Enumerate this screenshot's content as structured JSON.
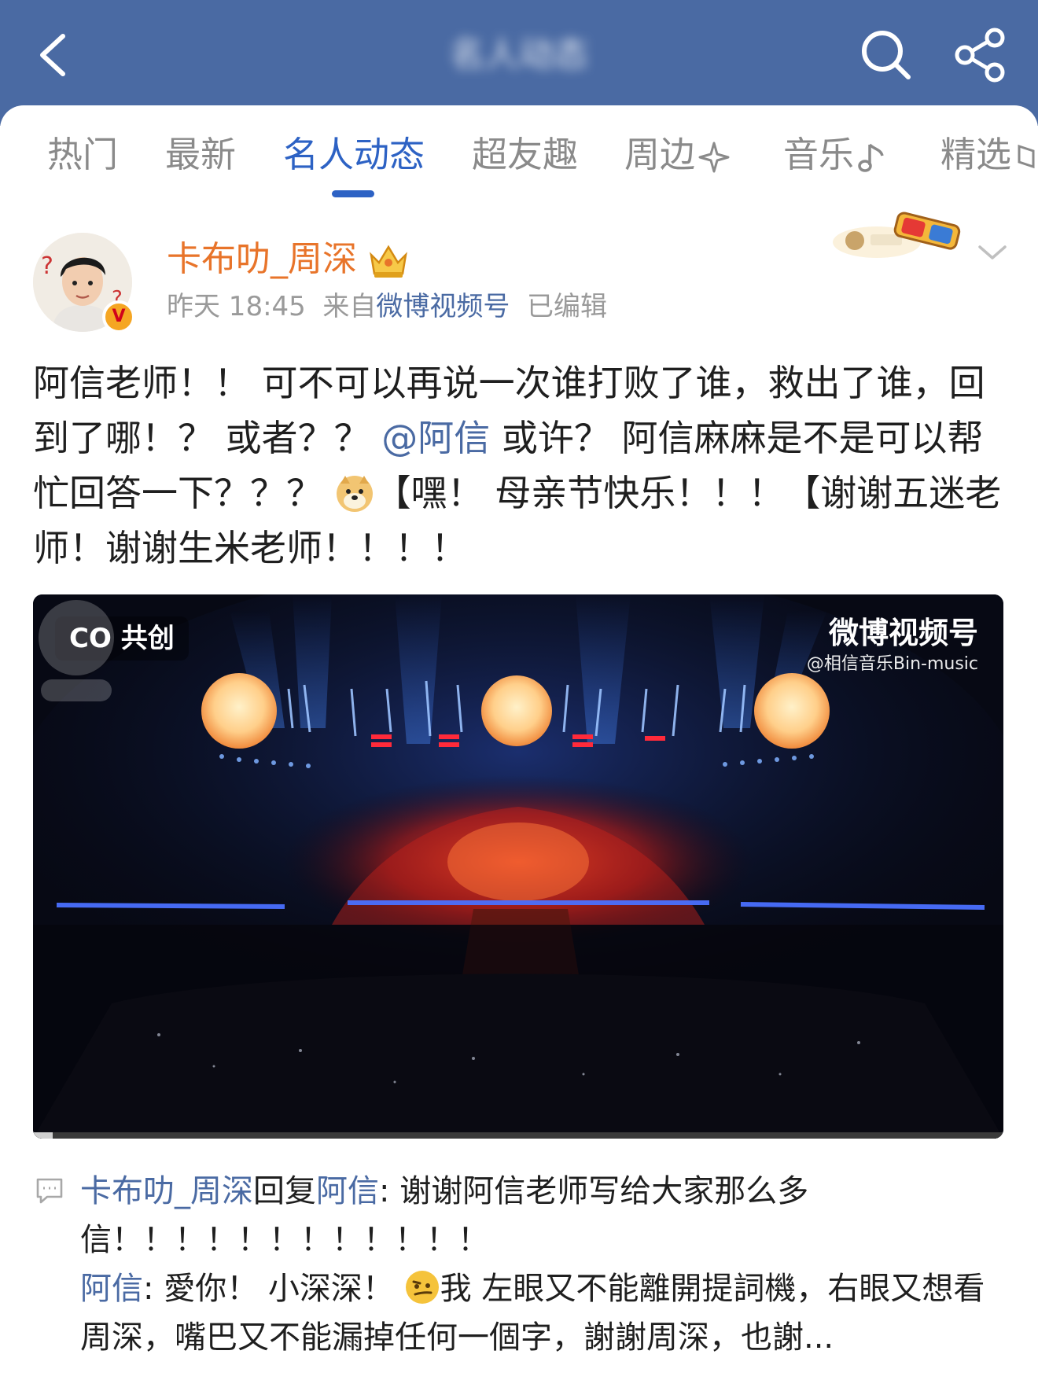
{
  "header": {
    "title": "名人动态",
    "back_icon": "back-arrow-icon",
    "search_icon": "search-icon",
    "share_icon": "share-icon",
    "bar_color": "#4a6aa3"
  },
  "tabs": [
    {
      "label": "热门"
    },
    {
      "label": "最新"
    },
    {
      "label": "名人动态",
      "active": true
    },
    {
      "label": "超友趣"
    },
    {
      "label": "周边"
    },
    {
      "label": "音乐"
    },
    {
      "label": "精选"
    }
  ],
  "post": {
    "author": "卡布叻_周深",
    "time": "昨天 18:45",
    "source_prefix": "来自",
    "source": "微博视频号",
    "edited": "已编辑",
    "text": {
      "part1": "阿信老师！！ 可不可以再说一次谁打败了谁，救出了谁，回到了哪！？ 或者？？ ",
      "mention": "@阿信",
      "part2": " 或许？ 阿信麻麻是不是可以帮忙回答一下？？？ ",
      "part3": "【嘿！ 母亲节快乐！！！【谢谢五迷老师！谢谢生米老师！！！！"
    },
    "video": {
      "badge": "CO 共创",
      "watermark_title": "微博视频号",
      "watermark_handle": "@相信音乐Bin-music",
      "progress": 0.02
    }
  },
  "comments": [
    {
      "name": "卡布叻_周深",
      "reply_word": "回复",
      "reply_to": "阿信",
      "text": ": 谢谢阿信老师写给大家那么多信！！！！！！！！！！！！"
    },
    {
      "name": "阿信",
      "text_before": ": 愛你！ 小深深！ ",
      "text_after": "我 左眼又不能離開提詞機，右眼又想看周深，嘴巴又不能漏掉任何一個字，謝謝周深，也謝..."
    }
  ],
  "colors": {
    "accent": "#2d62c4",
    "link": "#4a6aa3",
    "author": "#e8742a"
  }
}
